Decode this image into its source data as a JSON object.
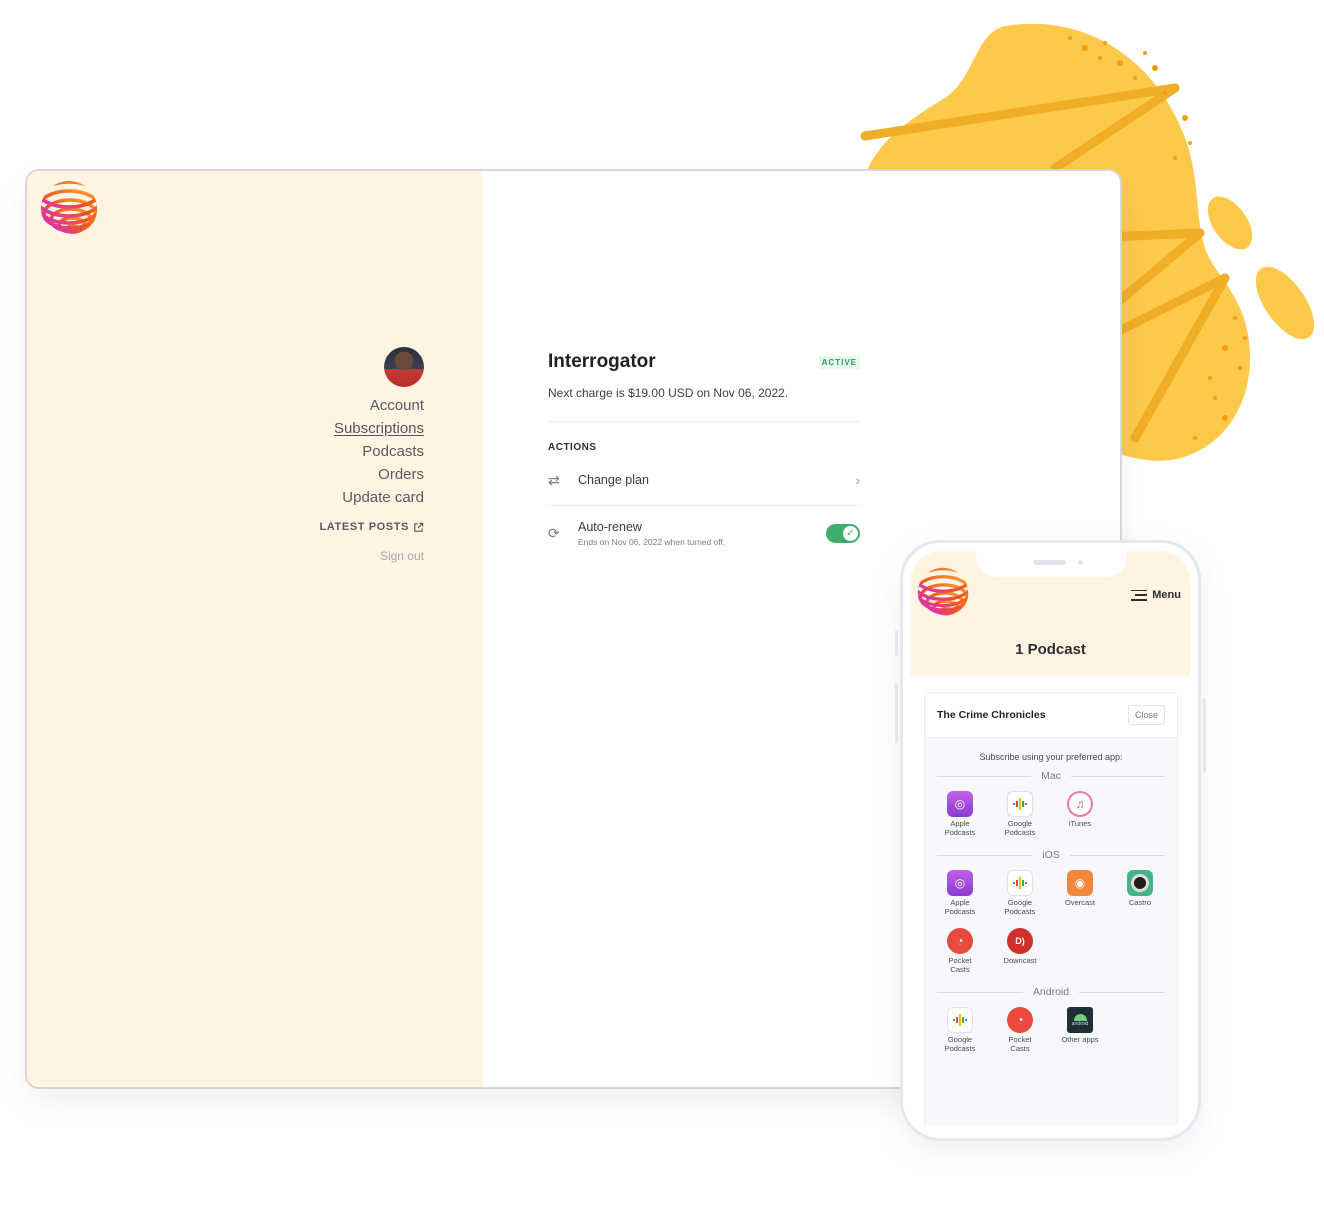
{
  "colors": {
    "sidebar_bg": "#fff3e2",
    "blob_yellow": "#fcc94b",
    "active_green": "#2c9a5b",
    "toggle_green": "#3fae6a"
  },
  "sidebar": {
    "logo_icon": "striped-globe-logo",
    "avatar": "user-avatar-photo",
    "nav": [
      {
        "label": "Account",
        "active": false
      },
      {
        "label": "Subscriptions",
        "active": true
      },
      {
        "label": "Podcasts",
        "active": false
      },
      {
        "label": "Orders",
        "active": false
      },
      {
        "label": "Update card",
        "active": false
      }
    ],
    "latest_posts": "LATEST POSTS",
    "latest_posts_icon": "external-link-icon",
    "sign_out": "Sign out"
  },
  "subscription": {
    "title": "Interrogator",
    "status": "ACTIVE",
    "next_charge": "Next charge is $19.00 USD on Nov 06, 2022.",
    "actions_label": "ACTIONS",
    "change_plan": {
      "label": "Change plan",
      "icon": "swap-arrows-icon"
    },
    "auto_renew": {
      "label": "Auto-renew",
      "sub": "Ends on Nov 06, 2022 when turned off.",
      "icon": "refresh-icon",
      "enabled": true
    }
  },
  "phone": {
    "menu_label": "Menu",
    "title": "1 Podcast",
    "podcast_name": "The Crime Chronicles",
    "close_label": "Close",
    "subscribe_prompt": "Subscribe using your preferred app:",
    "platforms": [
      {
        "name": "Mac",
        "apps": [
          {
            "label": "Apple Podcasts",
            "icon": "apple-podcasts"
          },
          {
            "label": "Google Podcasts",
            "icon": "google-podcasts"
          },
          {
            "label": "iTunes",
            "icon": "itunes"
          }
        ]
      },
      {
        "name": "iOS",
        "apps": [
          {
            "label": "Apple Podcasts",
            "icon": "apple-podcasts"
          },
          {
            "label": "Google Podcasts",
            "icon": "google-podcasts"
          },
          {
            "label": "Overcast",
            "icon": "overcast"
          },
          {
            "label": "Castro",
            "icon": "castro"
          },
          {
            "label": "Pocket Casts",
            "icon": "pocket-casts"
          },
          {
            "label": "Downcast",
            "icon": "downcast"
          }
        ]
      },
      {
        "name": "Android",
        "apps": [
          {
            "label": "Google Podcasts",
            "icon": "google-podcasts"
          },
          {
            "label": "Pocket Casts",
            "icon": "pocket-casts"
          },
          {
            "label": "Other apps",
            "icon": "android"
          }
        ]
      }
    ]
  }
}
